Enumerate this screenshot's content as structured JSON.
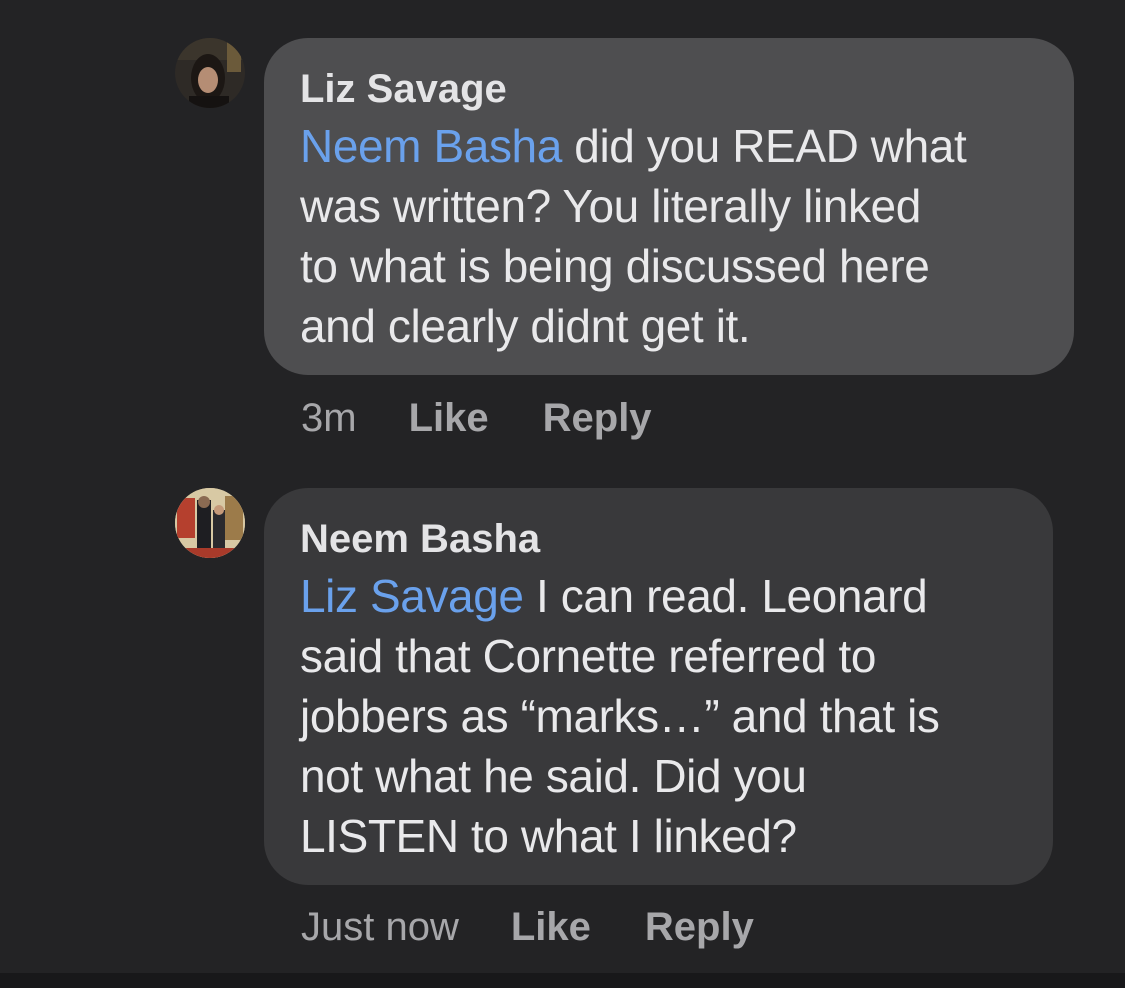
{
  "comments": [
    {
      "author": "Liz Savage",
      "mention": "Neem Basha",
      "text_lines": [
        " did you READ what",
        "was written? You literally linked",
        "to what is being discussed here",
        "and clearly didnt get it."
      ],
      "time": "3m",
      "like_label": "Like",
      "reply_label": "Reply"
    },
    {
      "author": "Neem Basha",
      "mention": "Liz Savage",
      "text_lines": [
        " I can read. Leonard",
        "said that Cornette referred to",
        "jobbers as “marks…” and that is",
        "not what he said. Did you",
        "LISTEN to what I linked?"
      ],
      "time": "Just now",
      "like_label": "Like",
      "reply_label": "Reply"
    }
  ],
  "colors": {
    "background": "#232325",
    "bubble_first": "#4e4e50",
    "bubble_second": "#39393b",
    "mention": "#6aa1ec",
    "meta_text": "#a7a7aa"
  }
}
